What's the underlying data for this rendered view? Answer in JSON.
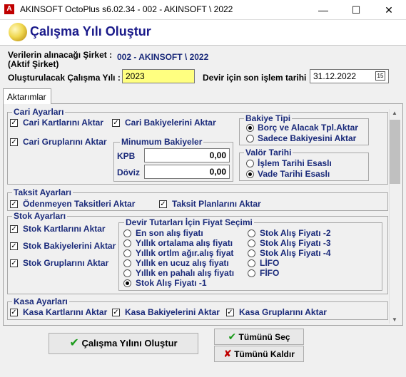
{
  "window": {
    "title": "AKINSOFT OctoPlus s6.02.34  -  002 - AKINSOFT \\ 2022",
    "min": "—",
    "max": "☐",
    "close": "✕",
    "icon": "app-icon"
  },
  "header": {
    "title": "Çalışma Yılı Oluştur",
    "icon": "globe-icon"
  },
  "form": {
    "company_label_line1": "Verilerin alınacağı Şirket :",
    "company_label_line2": "(Aktif Şirket)",
    "company_value": "002 - AKINSOFT \\ 2022",
    "year_label": "Oluşturulacak Çalışma Yılı :",
    "year_value": "2023",
    "last_date_label": "Devir için son işlem tarihi",
    "last_date_value": "31.12.2022",
    "calendar_icon": "15"
  },
  "tabs": [
    {
      "label": "Aktarımlar"
    }
  ],
  "cari": {
    "title": "Cari Ayarları",
    "kart": "Cari Kartlarını Aktar",
    "bakiye": "Cari Bakiyelerini Aktar",
    "grup": "Cari Gruplarını Aktar",
    "min_title": "Minumum Bakiyeler",
    "kpb_label": "KPB",
    "kpb_value": "0,00",
    "doviz_label": "Döviz",
    "doviz_value": "0,00",
    "bakiye_tipi_title": "Bakiye Tipi",
    "bakiye_tipi_opt1": "Borç ve Alacak Tpl.Aktar",
    "bakiye_tipi_opt2": "Sadece Bakiyesini Aktar",
    "valor_title": "Valör Tarihi",
    "valor_opt1": "İşlem Tarihi Esaslı",
    "valor_opt2": "Vade Tarihi Esaslı"
  },
  "taksit": {
    "title": "Taksit Ayarları",
    "odenmeyen": "Ödenmeyen Taksitleri Aktar",
    "plan": "Taksit Planlarını Aktar"
  },
  "stok": {
    "title": "Stok Ayarları",
    "kart": "Stok Kartlarını Aktar",
    "bakiye": "Stok Bakiyelerini Aktar",
    "grup": "Stok Gruplarını Aktar",
    "fiyat_title": "Devir Tutarları İçin Fiyat Seçimi",
    "fiyat_left": [
      "En son alış fiyatı",
      "Yıllık ortalama alış fiyatı",
      "Yıllık ortlm ağır.alış fiyat",
      "Yıllık en ucuz alış fiyatı",
      "Yıllık en pahalı alış fiyatı",
      "Stok Alış Fiyatı -1"
    ],
    "fiyat_right": [
      "Stok Alış Fiyatı -2",
      "Stok Alış Fiyatı -3",
      "Stok Alış Fiyatı -4",
      "LİFO",
      "FİFO"
    ]
  },
  "kasa": {
    "title": "Kasa Ayarları",
    "kart": "Kasa Kartlarını Aktar",
    "bakiye": "Kasa Bakiyelerini Aktar",
    "grup": "Kasa Gruplarını Aktar"
  },
  "buttons": {
    "create": "Çalışma Yılını Oluştur",
    "select_all": "Tümünü Seç",
    "remove_all": "Tümünü Kaldır"
  },
  "colors": {
    "title_blue": "#1a1a8a",
    "label_blue": "#1a2a7a",
    "check_green": "#1a9a1a",
    "cross_red": "#c00000",
    "year_bg": "#ffff80"
  }
}
